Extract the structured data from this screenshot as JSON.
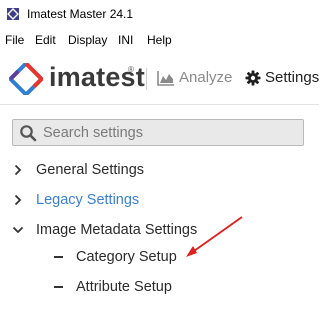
{
  "window": {
    "title": "Imatest Master 24.1"
  },
  "menubar": {
    "items": [
      "File",
      "Edit",
      "Display",
      "INI",
      "Help"
    ]
  },
  "toolbar": {
    "logo_text": "imatest",
    "logo_reg": "®",
    "analyze_label": "Analyze",
    "settings_label": "Settings"
  },
  "search": {
    "placeholder": "Search settings",
    "value": ""
  },
  "tree": {
    "general": "General Settings",
    "legacy": "Legacy Settings",
    "image_metadata": "Image Metadata Settings",
    "category_setup": "Category Setup",
    "attribute_setup": "Attribute Setup"
  },
  "colors": {
    "link": "#3a7fd6",
    "annotation_arrow": "#e0201a",
    "logo_red": "#e8352b",
    "logo_purple": "#5a3fa0",
    "logo_blue": "#2f7fd2"
  },
  "icons": {
    "app": "imatest-app-icon",
    "analyze": "chart-area-icon",
    "settings": "gear-icon",
    "search": "search-icon"
  }
}
